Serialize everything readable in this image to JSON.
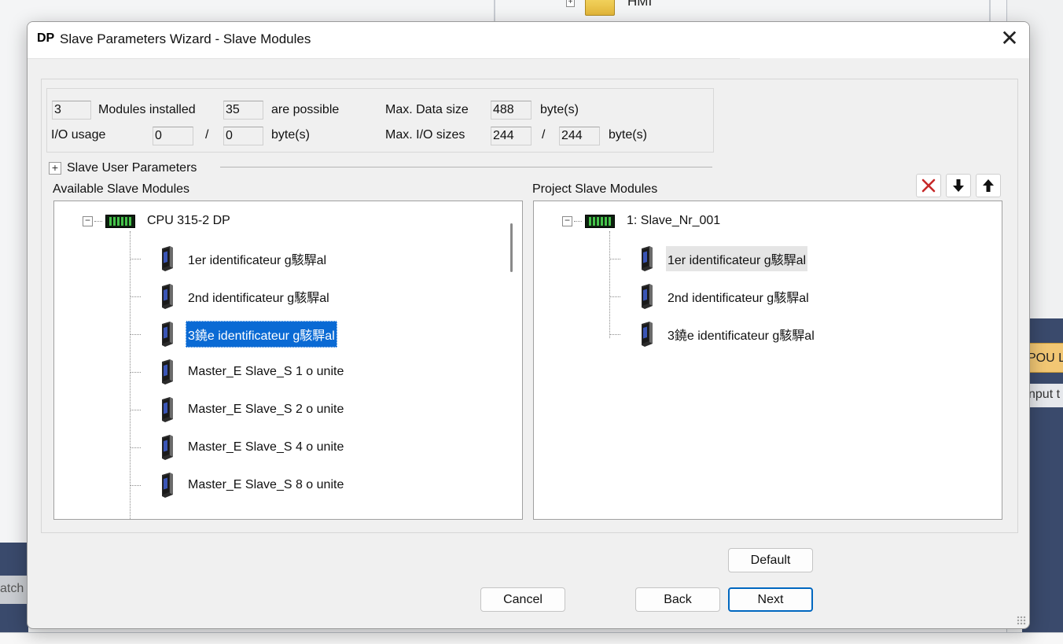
{
  "background": {
    "hmi_label": "HMI",
    "pou_tab": "POU L",
    "input_tab": "nput t",
    "watch_tab": "atch"
  },
  "dialog": {
    "title_icon": "DP",
    "title": "Slave Parameters Wizard - Slave Modules",
    "close_glyph": "✕"
  },
  "info": {
    "modules_installed_value": "3",
    "modules_installed_label": "Modules installed",
    "possible_value": "35",
    "possible_label": "are possible",
    "io_usage_label": "I/O usage",
    "io_in_value": "0",
    "io_separator": "/",
    "io_out_value": "0",
    "io_unit": "byte(s)",
    "max_data_label": "Max. Data size",
    "max_data_value": "488",
    "max_data_unit": "byte(s)",
    "max_io_label": "Max. I/O sizes",
    "max_io_in_value": "244",
    "max_io_separator": "/",
    "max_io_out_value": "244",
    "max_io_unit": "byte(s)"
  },
  "user_params": {
    "expand_glyph": "+",
    "label": "Slave User Parameters"
  },
  "available": {
    "header": "Available Slave Modules",
    "root_label": "CPU 315-2 DP",
    "modules": [
      {
        "label": "1er identificateur g駭駻al"
      },
      {
        "label": "2nd identificateur g駭駻al"
      },
      {
        "label": "3鐃e identificateur g駭駻al"
      },
      {
        "label": "Master_E Slave_S  1 o unite"
      },
      {
        "label": "Master_E Slave_S  2 o unite"
      },
      {
        "label": "Master_E Slave_S  4 o unite"
      },
      {
        "label": "Master_E Slave_S  8 o unite"
      }
    ]
  },
  "project": {
    "header": "Project Slave Modules",
    "root_label": "1: Slave_Nr_001",
    "modules": [
      {
        "label": "1er identificateur g駭駻al"
      },
      {
        "label": "2nd identificateur g駭駻al"
      },
      {
        "label": "3鐃e identificateur g駭駻al"
      }
    ]
  },
  "toolbar": {
    "delete_icon": "delete-x-icon",
    "move_down_icon": "arrow-down-icon",
    "move_up_icon": "arrow-up-icon",
    "delete_color": "#c62828"
  },
  "buttons": {
    "default_label": "Default",
    "cancel_label": "Cancel",
    "back_label": "Back",
    "next_label": "Next"
  },
  "colors": {
    "selection": "#0a6ad4",
    "primary_border": "#0067c0"
  }
}
